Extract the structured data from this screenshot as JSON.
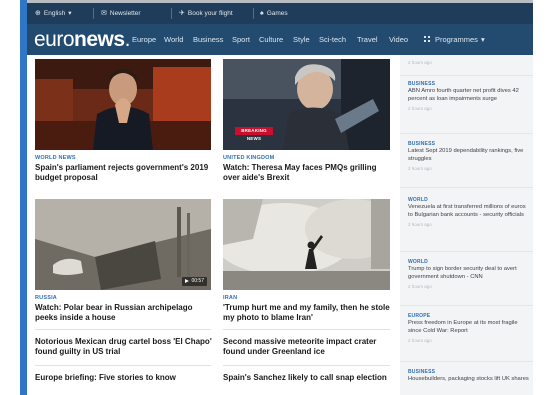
{
  "topbar": {
    "language": "English",
    "newsletter": "Newsletter",
    "book_flight": "Book your flight",
    "games": "Games"
  },
  "nav": {
    "logo_light": "euro",
    "logo_bold": "news",
    "items": [
      "Europe",
      "World",
      "Business",
      "Sport",
      "Culture",
      "Style",
      "Sci-tech",
      "Travel",
      "Video"
    ],
    "programmes": "Programmes"
  },
  "main": {
    "stories": [
      {
        "category": "WORLD NEWS",
        "title": "Spain's parliament rejects government's 2019 budget proposal"
      },
      {
        "category": "UNITED KINGDOM",
        "title": "Watch: Theresa May faces PMQs grilling over aide's Brexit"
      },
      {
        "category": "RUSSIA",
        "title": "Watch: Polar bear in Russian archipelago peeks inside a house"
      },
      {
        "category": "IRAN",
        "title": "'Trump hurt me and my family, then he stole my photo to blame Iran'"
      }
    ],
    "breaking_label": "BREAKING NEWS",
    "video_duration": "00:57",
    "more_stories": [
      "Notorious Mexican drug cartel boss 'El Chapo' found guilty in US trial",
      "Second massive meteorite impact crater found under Greenland ice",
      "Europe briefing: Five stories to know",
      "Spain's Sanchez likely to call snap election"
    ]
  },
  "sidebar": {
    "items": [
      {
        "category": "BUSINESS",
        "title": "ABN Amro fourth quarter net profit dives 42 percent as loan impairments surge",
        "time": "2 hours ago"
      },
      {
        "category": "BUSINESS",
        "title": "Latest Sept 2019 dependability rankings, five struggles",
        "time": "2 hours ago"
      },
      {
        "category": "WORLD",
        "title": "Venezuela at first transferred millions of euros to Bulgarian bank accounts - security officials",
        "time": "2 hours ago"
      },
      {
        "category": "WORLD",
        "title": "Trump to sign border security deal to avert government shutdown - CNN",
        "time": "2 hours ago"
      },
      {
        "category": "EUROPE",
        "title": "Press freedom in Europe at its most fragile since Cold War: Report",
        "time": "2 hours ago"
      },
      {
        "category": "BUSINESS",
        "title": "Housebuilders, packaging stocks lift UK shares",
        "time": "2 hours ago"
      }
    ]
  },
  "colors": {
    "topbar": "#1f3d5a",
    "navbar": "#234b70",
    "accent": "#2f6fb5",
    "breaking": "#c8102e",
    "frame": "#2f77c6"
  }
}
